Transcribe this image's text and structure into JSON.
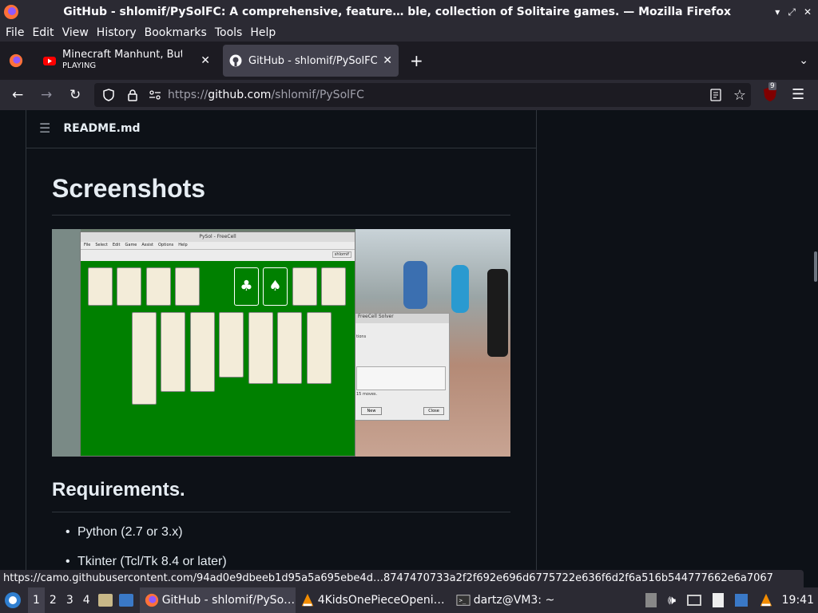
{
  "window": {
    "title": "GitHub - shlomif/PySolFC: A comprehensive, feature… ble, collection of Solitaire games. — Mozilla Firefox"
  },
  "menu": [
    "File",
    "Edit",
    "View",
    "History",
    "Bookmarks",
    "Tools",
    "Help"
  ],
  "tabs": [
    {
      "title": "Minecraft Manhunt, But I",
      "subtitle": "PLAYING"
    },
    {
      "title": "GitHub - shlomif/PySolFC"
    }
  ],
  "url": {
    "prefix": "https://",
    "host": "github.com",
    "path": "/shlomif/PySolFC"
  },
  "extension_badge": "9",
  "readme": {
    "file_label": "README.md",
    "screenshots_heading": "Screenshots",
    "requirements_heading": "Requirements.",
    "requirements": [
      "Python (2.7 or 3.x)",
      "Tkinter (Tcl/Tk 8.4 or later)"
    ]
  },
  "screenshot_window": {
    "title": "PySol - FreeCell",
    "menu": [
      "File",
      "Select",
      "Edit",
      "Game",
      "Assist",
      "Options",
      "Help"
    ],
    "user": "shlomif",
    "solver_title": "FreeCell Solver",
    "solver_options": "tions",
    "solver_moves": "15 moves.",
    "solver_new": "New",
    "solver_close": "Close"
  },
  "status_url": "https://camo.githubusercontent.com/94ad0e9dbeeb1d95a5a695ebe4d…8747470733a2f2f692e696d6775722e636f6d2f6a516b544777662e6a7067",
  "taskbar": {
    "workspaces": [
      "1",
      "2",
      "3",
      "4"
    ],
    "tasks": [
      "GitHub - shlomif/PySo…",
      "4KidsOnePieceOpeni…",
      "dartz@VM3: ~"
    ],
    "clock": "19:41"
  },
  "colors": {
    "page_bg": "#0d1117",
    "text": "#e6edf3",
    "border": "#30363d",
    "browser_chrome": "#2b2a33",
    "felt": "#008000"
  }
}
